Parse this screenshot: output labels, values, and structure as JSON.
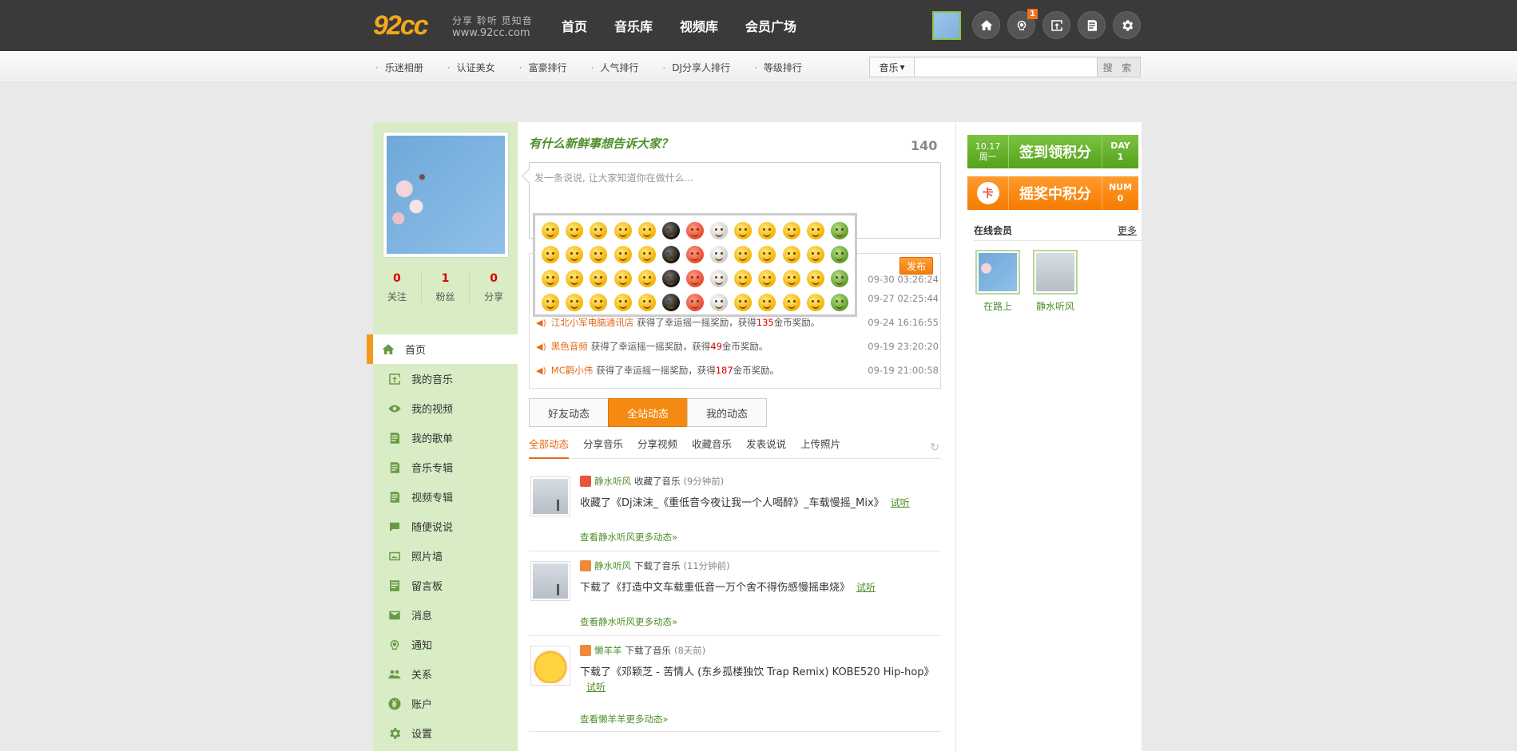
{
  "logo": {
    "mark": "92cc",
    "tagline": "分享 聆听 觅知音",
    "domain": "www.92cc.com"
  },
  "main_nav": [
    "首页",
    "音乐库",
    "视频库",
    "会员广场"
  ],
  "top_icons": [
    "home-icon",
    "broadcast-icon",
    "upload-icon",
    "list-icon",
    "gear-icon"
  ],
  "notification_badge": "1",
  "sub_nav": [
    "乐迷相册",
    "认证美女",
    "富豪排行",
    "人气排行",
    "DJ分享人排行",
    "等级排行"
  ],
  "search": {
    "type": "音乐",
    "placeholder": "",
    "button": "搜 索"
  },
  "profile": {
    "stats": [
      {
        "num": "0",
        "label": "关注"
      },
      {
        "num": "1",
        "label": "粉丝"
      },
      {
        "num": "0",
        "label": "分享"
      }
    ]
  },
  "left_nav": [
    {
      "label": "首页",
      "icon": "home-icon"
    },
    {
      "label": "我的音乐",
      "icon": "music-icon"
    },
    {
      "label": "我的视频",
      "icon": "eye-icon"
    },
    {
      "label": "我的歌单",
      "icon": "list-icon"
    },
    {
      "label": "音乐专辑",
      "icon": "album-icon"
    },
    {
      "label": "视频专辑",
      "icon": "video-album-icon"
    },
    {
      "label": "随便说说",
      "icon": "chat-icon"
    },
    {
      "label": "照片墙",
      "icon": "photo-icon"
    },
    {
      "label": "留言板",
      "icon": "board-icon"
    },
    {
      "label": "消息",
      "icon": "mail-icon"
    },
    {
      "label": "通知",
      "icon": "bell-icon"
    },
    {
      "label": "关系",
      "icon": "people-icon"
    },
    {
      "label": "账户",
      "icon": "yen-icon"
    },
    {
      "label": "设置",
      "icon": "gear-icon"
    }
  ],
  "compose": {
    "title": "有什么新鲜事想告诉大家？",
    "count": "140",
    "placeholder": "发一条说说, 让大家知道你在做什么...",
    "publish": "发布"
  },
  "ticker": [
    {
      "user": "",
      "text": "",
      "amount": "",
      "suffix": "",
      "time": "09-30 03:26:24"
    },
    {
      "user": "",
      "text": "",
      "amount": "",
      "suffix": "",
      "time": "09-27 02:25:44"
    },
    {
      "user": "江北小军电脑通讯店",
      "text": "获得了幸运摇一摇奖励，获得",
      "amount": "135",
      "suffix": "金币奖励。",
      "time": "09-24 16:16:55"
    },
    {
      "user": "黑色音频",
      "text": "获得了幸运摇一摇奖励，获得",
      "amount": "49",
      "suffix": "金币奖励。",
      "time": "09-19 23:20:20"
    },
    {
      "user": "MC鹳小伟",
      "text": "获得了幸运摇一摇奖励，获得",
      "amount": "187",
      "suffix": "金币奖励。",
      "time": "09-19 21:00:58"
    }
  ],
  "feed_tabs": [
    "好友动态",
    "全站动态",
    "我的动态"
  ],
  "feed_filters": [
    "全部动态",
    "分享音乐",
    "分享视频",
    "收藏音乐",
    "发表说说",
    "上传照片"
  ],
  "feed": [
    {
      "user": "静水听风",
      "action": "收藏了音乐",
      "ago": "(9分钟前)",
      "body": "收藏了《Dj沫沫_《重低音今夜让我一个人喝醉》_车载慢摇_Mix》",
      "try": "试听",
      "more": "查看静水听风更多动态»"
    },
    {
      "user": "静水听风",
      "action": "下载了音乐",
      "ago": "(11分钟前)",
      "body": "下载了《打造中文车载重低音一万个舍不得伤感慢摇串烧》",
      "try": "试听",
      "more": "查看静水听风更多动态»"
    },
    {
      "user": "懒羊羊",
      "action": "下载了音乐",
      "ago": "(8天前)",
      "body": "下载了《邓颖芝 - 苦情人 (东乡孤楼独饮 Trap Remix) KOBE520 Hip-hop》",
      "try": "试听",
      "more": "查看懒羊羊更多动态»"
    }
  ],
  "sign_card": {
    "date": "10.17",
    "weekday": "周一",
    "label": "签到领积分",
    "right_top": "DAY",
    "right_bottom": "1"
  },
  "lottery_card": {
    "icon": "gift-icon",
    "label": "摇奖中积分",
    "right_top": "NUM",
    "right_bottom": "0"
  },
  "online": {
    "title": "在线会员",
    "more": "更多",
    "members": [
      "在路上",
      "静水听风"
    ]
  },
  "colors": {
    "accent_green": "#4f8f2a",
    "accent_orange": "#f58a12",
    "topbar": "#3a3a3a",
    "sidebar": "#d8edc5"
  }
}
